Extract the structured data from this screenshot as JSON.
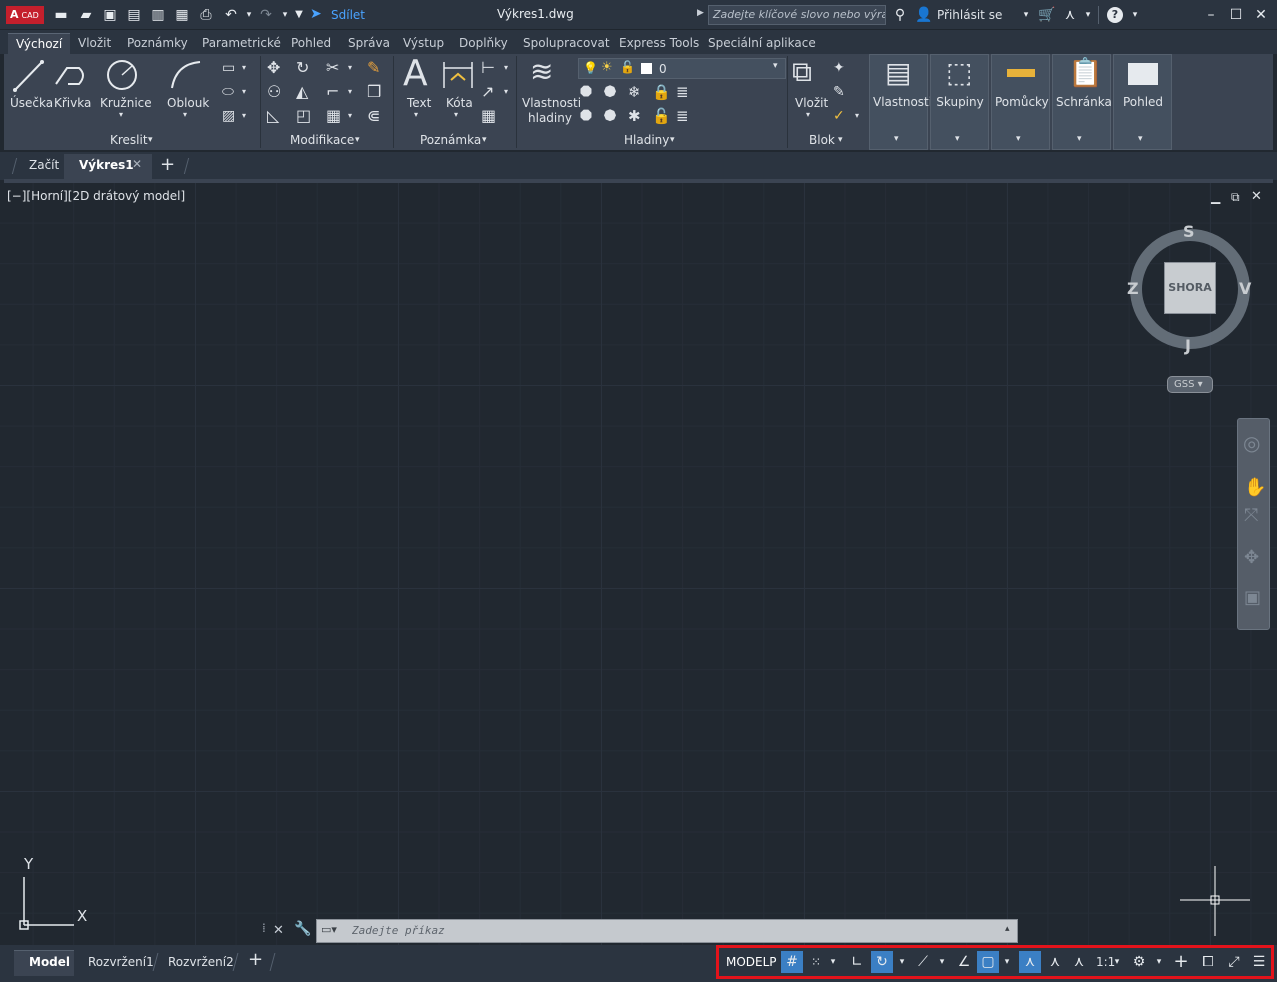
{
  "app": {
    "logo_text": "A",
    "logo_sub": "CAD",
    "window_title": "Výkres1.dwg",
    "share_label": "Sdílet",
    "search_placeholder": "Zadejte klíčové slovo nebo výraz.",
    "signin_label": "Přihlásit se"
  },
  "ribbon_tabs": [
    "Výchozí",
    "Vložit",
    "Poznámky",
    "Parametrické",
    "Pohled",
    "Správa",
    "Výstup",
    "Doplňky",
    "Spolupracovat",
    "Express Tools",
    "Speciální aplikace"
  ],
  "ribbon": {
    "draw": {
      "line": "Úsečka",
      "polyline": "Křivka",
      "circle": "Kružnice",
      "arc": "Oblouk",
      "panel": "Kreslit"
    },
    "modify": {
      "panel": "Modifikace"
    },
    "annotation": {
      "text": "Text",
      "dimension": "Kóta",
      "panel": "Poznámka"
    },
    "layers": {
      "props_line1": "Vlastnosti",
      "props_line2": "hladiny",
      "current_layer": "0",
      "panel": "Hladiny"
    },
    "block": {
      "insert": "Vložit",
      "panel": "Blok"
    },
    "groups": {
      "properties": "Vlastnosti",
      "groups": "Skupiny",
      "utilities": "Pomůcky",
      "clipboard": "Schránka",
      "view": "Pohled"
    }
  },
  "file_tabs": {
    "start": "Začít",
    "drawing": "Výkres1"
  },
  "viewport": {
    "label": "[−][Horní][2D drátový model]",
    "viewcube": {
      "top_face": "SHORA",
      "north": "S",
      "south": "J",
      "east": "V",
      "west": "Z",
      "ucs": "GSS"
    },
    "ucs_x": "X",
    "ucs_y": "Y"
  },
  "command_line": {
    "placeholder": "Zadejte příkaz"
  },
  "layout_tabs": [
    "Model",
    "Rozvržení1",
    "Rozvržení2"
  ],
  "statusbar": {
    "model_label": "MODELP",
    "scale": "1:1"
  },
  "colors": {
    "highlight_border": "#e3131b",
    "active_toggle": "#3b7fc4",
    "canvas": "#212830"
  }
}
